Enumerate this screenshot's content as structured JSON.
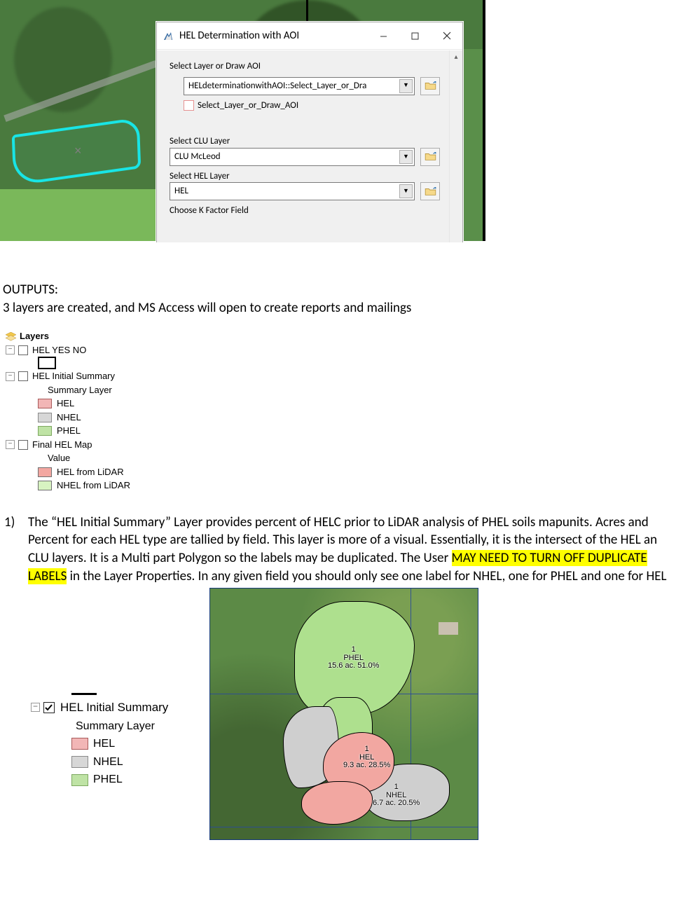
{
  "dialog": {
    "title": "HEL Determination with AOI",
    "section_aoi_label": "Select Layer or Draw AOI",
    "aoi_combo_text": "HELdeterminationwithAOI::Select_Layer_or_Dra",
    "aoi_checkbox_label": "Select_Layer_or_Draw_AOI",
    "clu_label": "Select CLU Layer",
    "clu_value": "CLU McLeod",
    "hel_label": "Select HEL Layer",
    "hel_value": "HEL",
    "kfactor_label": "Choose K Factor Field"
  },
  "outputs": {
    "heading": "OUTPUTS:",
    "sub": "3 layers are created, and MS Access will open to create reports and mailings"
  },
  "layers_panel": {
    "title": "Layers",
    "nodes": {
      "n1": "HEL YES NO",
      "n2": "HEL Initial Summary",
      "n2_sub": "Summary Layer",
      "hel": "HEL",
      "nhel": "NHEL",
      "phel": "PHEL",
      "n3": "Final HEL Map",
      "n3_sub": "Value",
      "hel_lidar": "HEL from LiDAR",
      "nhel_lidar": "NHEL from LiDAR"
    }
  },
  "para1": {
    "num": "1)",
    "pre": "The “HEL Initial Summary” Layer provides percent of HELC prior to LiDAR analysis of PHEL soils mapunits. Acres and Percent for each HEL type are tallied by field. This layer is more of a visual. Essentially, it is the intersect of the HEL an CLU layers. It is a Multi part Polygon so the labels may be duplicated. The User ",
    "hl": "MAY NEED TO TURN OFF DUPLICATE LABELS",
    "post": " in the Layer Properties. In any given field you should only see one label for NHEL, one for PHEL and one for HEL"
  },
  "legend2": {
    "title": "HEL Initial Summary",
    "sub": "Summary Layer",
    "hel": "HEL",
    "nhel": "NHEL",
    "phel": "PHEL"
  },
  "map_labels": {
    "phel_id": "1",
    "phel_name": "PHEL",
    "phel_stat": "15.6 ac. 51.0%",
    "hel_id": "1",
    "hel_name": "HEL",
    "hel_stat": "9.3 ac. 28.5%",
    "nhel_id": "1",
    "nhel_name": "NHEL",
    "nhel_stat": "6.7 ac. 20.5%"
  }
}
